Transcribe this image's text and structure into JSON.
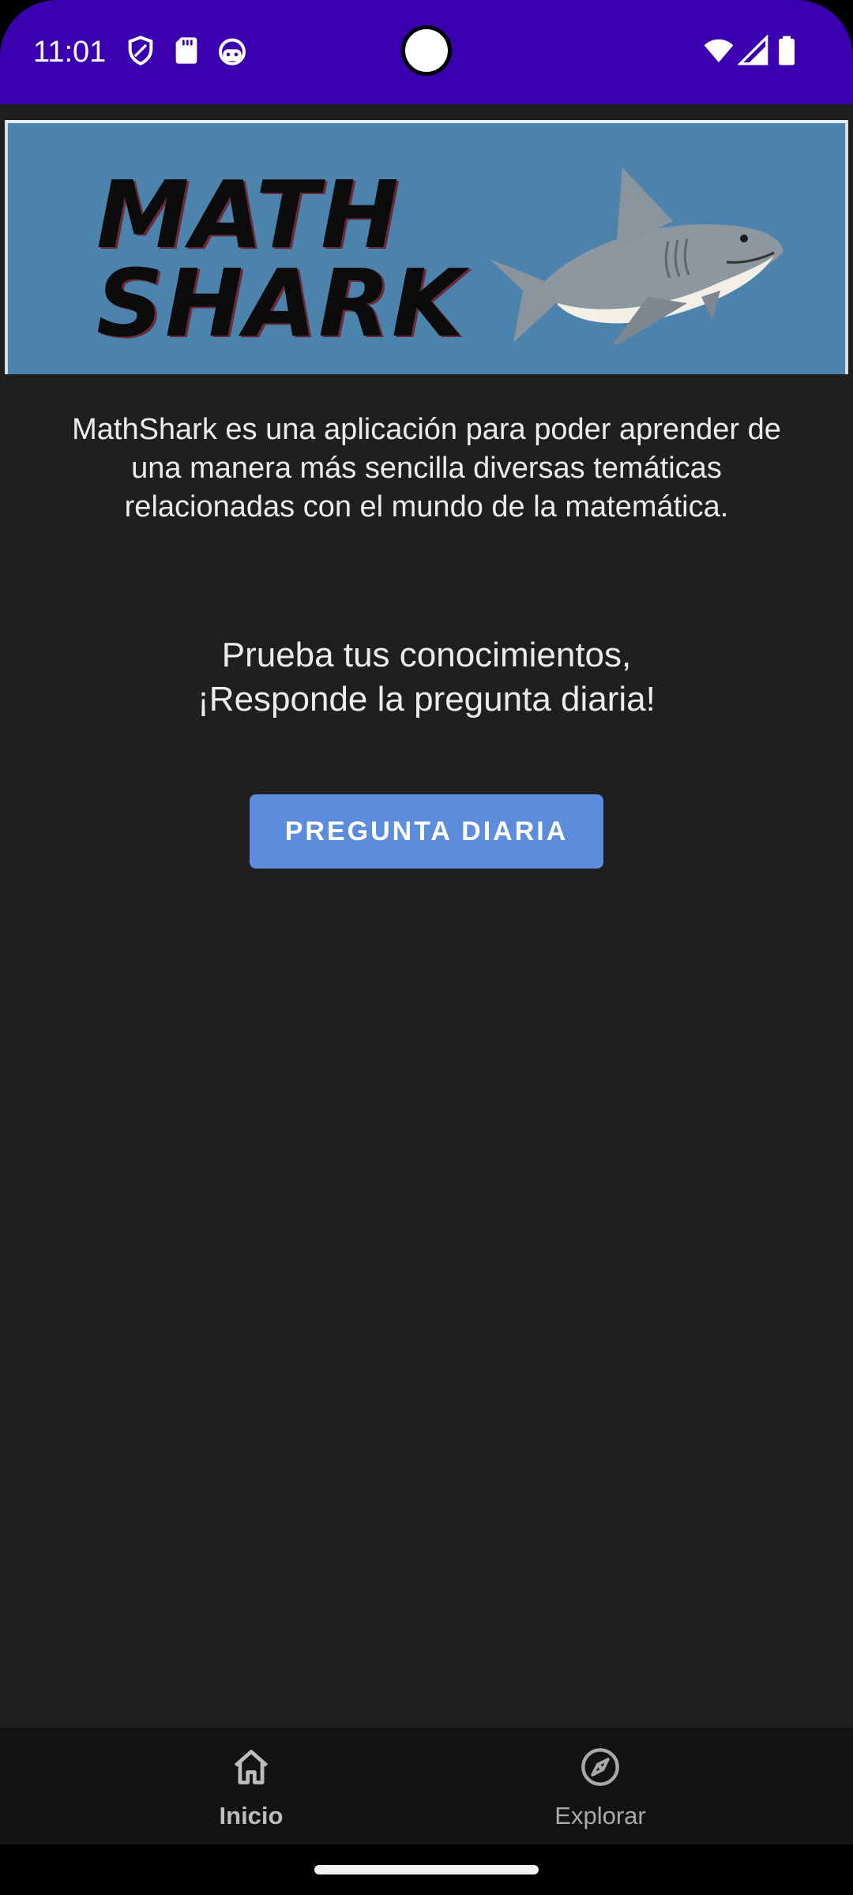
{
  "status_bar": {
    "time": "11:01",
    "left_icons": [
      "shield-icon",
      "sd-card-icon",
      "android-face-icon"
    ],
    "right_icons": [
      "wifi-icon",
      "signal-icon",
      "battery-icon"
    ],
    "background": "#3a00b0"
  },
  "banner": {
    "logo_line1": "MATH",
    "logo_line2": "SHARK",
    "background": "#4b83ac"
  },
  "content": {
    "description": "MathShark es una aplicación para poder aprender de una manera más sencilla diversas temáticas relacionadas con el mundo de la matemática.",
    "prompt_line1": "Prueba tus conocimientos,",
    "prompt_line2": "¡Responde la pregunta diaria!",
    "button_label": "PREGUNTA DIARIA",
    "button_color": "#5b8ddc"
  },
  "bottom_nav": {
    "items": [
      {
        "label": "Inicio",
        "icon": "home-icon",
        "active": true
      },
      {
        "label": "Explorar",
        "icon": "compass-icon",
        "active": false
      }
    ]
  }
}
